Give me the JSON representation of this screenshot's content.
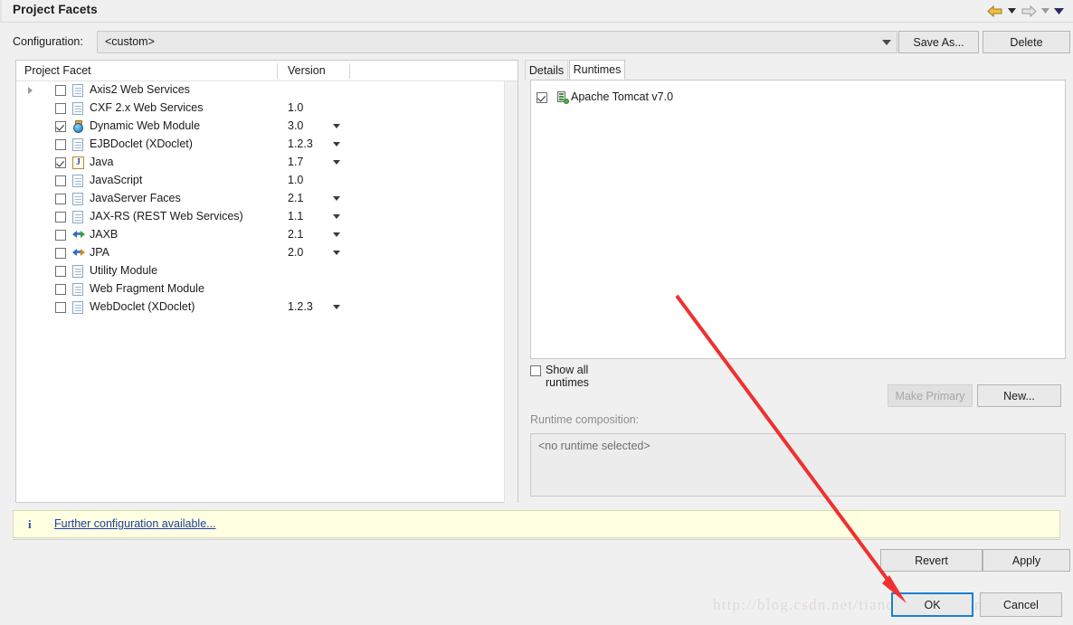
{
  "window": {
    "title": "Project Facets",
    "nav": {
      "back_icon": "arrow-left-icon",
      "back_dropdown_icon": "chevron-down-icon",
      "forward_icon": "arrow-right-icon",
      "forward_dropdown_icon": "chevron-down-icon",
      "menu_icon": "chevron-down-icon"
    }
  },
  "config": {
    "label": "Configuration:",
    "value": "<custom>",
    "dropdown_icon": "chevron-down-icon",
    "save_as_label": "Save As...",
    "delete_label": "Delete"
  },
  "facet_table": {
    "columns": [
      "Project Facet",
      "Version"
    ],
    "rows": [
      {
        "name": "Axis2 Web Services",
        "version": "",
        "checked": false,
        "expandable": true,
        "icon": "document-icon",
        "dropdown": false
      },
      {
        "name": "CXF 2.x Web Services",
        "version": "1.0",
        "checked": false,
        "expandable": false,
        "icon": "document-icon",
        "dropdown": false
      },
      {
        "name": "Dynamic Web Module",
        "version": "3.0",
        "checked": true,
        "expandable": false,
        "icon": "web-module-icon",
        "dropdown": true
      },
      {
        "name": "EJBDoclet (XDoclet)",
        "version": "1.2.3",
        "checked": false,
        "expandable": false,
        "icon": "document-icon",
        "dropdown": true
      },
      {
        "name": "Java",
        "version": "1.7",
        "checked": true,
        "expandable": false,
        "icon": "java-icon",
        "dropdown": true
      },
      {
        "name": "JavaScript",
        "version": "1.0",
        "checked": false,
        "expandable": false,
        "icon": "document-icon",
        "dropdown": false
      },
      {
        "name": "JavaServer Faces",
        "version": "2.1",
        "checked": false,
        "expandable": false,
        "icon": "document-icon",
        "dropdown": true
      },
      {
        "name": "JAX-RS (REST Web Services)",
        "version": "1.1",
        "checked": false,
        "expandable": false,
        "icon": "document-icon",
        "dropdown": true
      },
      {
        "name": "JAXB",
        "version": "2.1",
        "checked": false,
        "expandable": false,
        "icon": "arrows-green-icon",
        "dropdown": true
      },
      {
        "name": "JPA",
        "version": "2.0",
        "checked": false,
        "expandable": false,
        "icon": "arrows-orange-icon",
        "dropdown": true
      },
      {
        "name": "Utility Module",
        "version": "",
        "checked": false,
        "expandable": false,
        "icon": "document-icon",
        "dropdown": false
      },
      {
        "name": "Web Fragment Module",
        "version": "",
        "checked": false,
        "expandable": false,
        "icon": "document-icon",
        "dropdown": false
      },
      {
        "name": "WebDoclet (XDoclet)",
        "version": "1.2.3",
        "checked": false,
        "expandable": false,
        "icon": "document-icon",
        "dropdown": true
      }
    ]
  },
  "right_panel": {
    "tabs": [
      {
        "label": "Details",
        "active": false
      },
      {
        "label": "Runtimes",
        "active": true
      }
    ],
    "runtimes": [
      {
        "label": "Apache Tomcat v7.0",
        "checked": true,
        "icon": "server-icon"
      }
    ],
    "show_all_runtimes": {
      "label": "Show all runtimes",
      "checked": false
    },
    "make_primary_label": "Make Primary",
    "new_label": "New...",
    "runtime_composition_label": "Runtime composition:",
    "runtime_composition_value": "<no runtime selected>"
  },
  "info_bar": {
    "icon": "info-icon",
    "link_text": "Further configuration available..."
  },
  "footer": {
    "revert_label": "Revert",
    "apply_label": "Apply",
    "ok_label": "OK",
    "cancel_label": "Cancel"
  },
  "watermark": {
    "text": "http://blog.csdn.net/tiandixuanwuliang"
  },
  "colors": {
    "accent_focus": "#1b7fd1",
    "annotation_arrow": "#f03030",
    "info_bar_bg": "#ffffe1",
    "link": "#1d3f9e"
  }
}
